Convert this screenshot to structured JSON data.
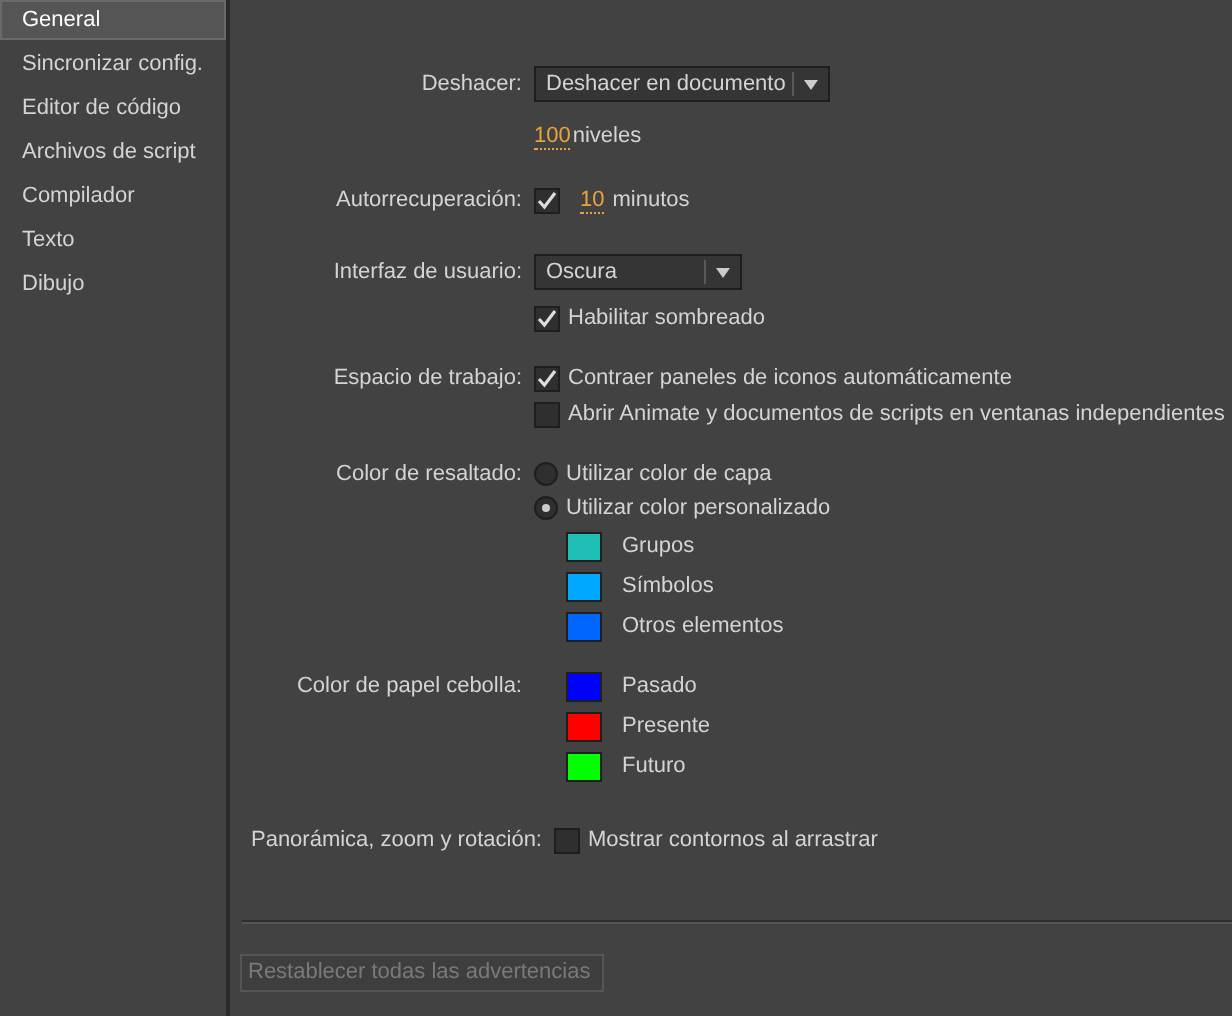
{
  "sidebar": {
    "items": [
      {
        "label": "General",
        "selected": true
      },
      {
        "label": "Sincronizar config.",
        "selected": false
      },
      {
        "label": "Editor de código",
        "selected": false
      },
      {
        "label": "Archivos de script",
        "selected": false
      },
      {
        "label": "Compilador",
        "selected": false
      },
      {
        "label": "Texto",
        "selected": false
      },
      {
        "label": "Dibujo",
        "selected": false
      }
    ]
  },
  "undo": {
    "label": "Deshacer:",
    "dropdown": {
      "value": "Deshacer en documento"
    },
    "levels_value": "100",
    "levels_unit": "niveles"
  },
  "autorecovery": {
    "label": "Autorrecuperación:",
    "checked": true,
    "value": "10",
    "unit": "minutos"
  },
  "user_interface": {
    "label": "Interfaz de usuario:",
    "dropdown": {
      "value": "Oscura"
    },
    "shading": {
      "label": "Habilitar sombreado",
      "checked": true
    }
  },
  "workspace": {
    "label": "Espacio de trabajo:",
    "options": [
      {
        "label": "Contraer paneles de iconos automáticamente",
        "checked": true
      },
      {
        "label": "Abrir Animate y documentos de scripts en ventanas independientes",
        "checked": false
      }
    ]
  },
  "highlight_color": {
    "label": "Color de resaltado:",
    "options": [
      {
        "label": "Utilizar color de capa",
        "selected": false
      },
      {
        "label": "Utilizar color personalizado",
        "selected": true
      }
    ],
    "colors": [
      {
        "label": "Grupos",
        "color": "#1fbfb8"
      },
      {
        "label": "Símbolos",
        "color": "#00a8ff"
      },
      {
        "label": "Otros elementos",
        "color": "#0066ff"
      }
    ]
  },
  "onion_skin_color": {
    "label": "Color de papel cebolla:",
    "colors": [
      {
        "label": "Pasado",
        "color": "#0000ff"
      },
      {
        "label": "Presente",
        "color": "#ff0000"
      },
      {
        "label": "Futuro",
        "color": "#00ff00"
      }
    ]
  },
  "pan_zoom_rotate": {
    "label": "Panorámica, zoom y rotación:",
    "option": {
      "label": "Mostrar contornos al arrastrar",
      "checked": false
    }
  },
  "reset_button": {
    "label": "Restablecer todas las advertencias",
    "disabled": true
  }
}
